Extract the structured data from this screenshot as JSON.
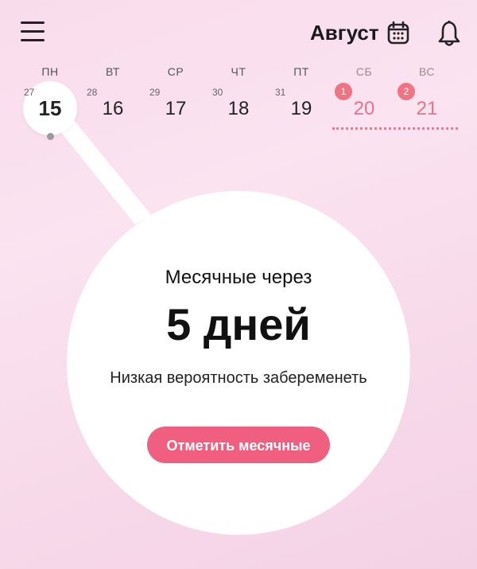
{
  "header": {
    "month": "Август",
    "menu_icon": "hamburger-menu-icon",
    "calendar_icon": "calendar-icon",
    "bell_icon": "bell-icon"
  },
  "week": [
    {
      "weekday": "ПН",
      "cycle_day": "27",
      "date": "15",
      "selected": true
    },
    {
      "weekday": "ВТ",
      "cycle_day": "28",
      "date": "16"
    },
    {
      "weekday": "СР",
      "cycle_day": "29",
      "date": "17"
    },
    {
      "weekday": "ЧТ",
      "cycle_day": "30",
      "date": "18"
    },
    {
      "weekday": "ПТ",
      "cycle_day": "31",
      "date": "19"
    },
    {
      "weekday": "СБ",
      "badge": "1",
      "date": "20",
      "period": true
    },
    {
      "weekday": "ВС",
      "badge": "2",
      "date": "21",
      "period": true
    }
  ],
  "main": {
    "subtitle": "Месячные через",
    "countdown": "5 дней",
    "note": "Низкая вероятность забеременеть",
    "cta_label": "Отметить месячные"
  },
  "colors": {
    "accent": "#f05f7f",
    "period_text": "#e8738a",
    "badge": "#f07283"
  }
}
